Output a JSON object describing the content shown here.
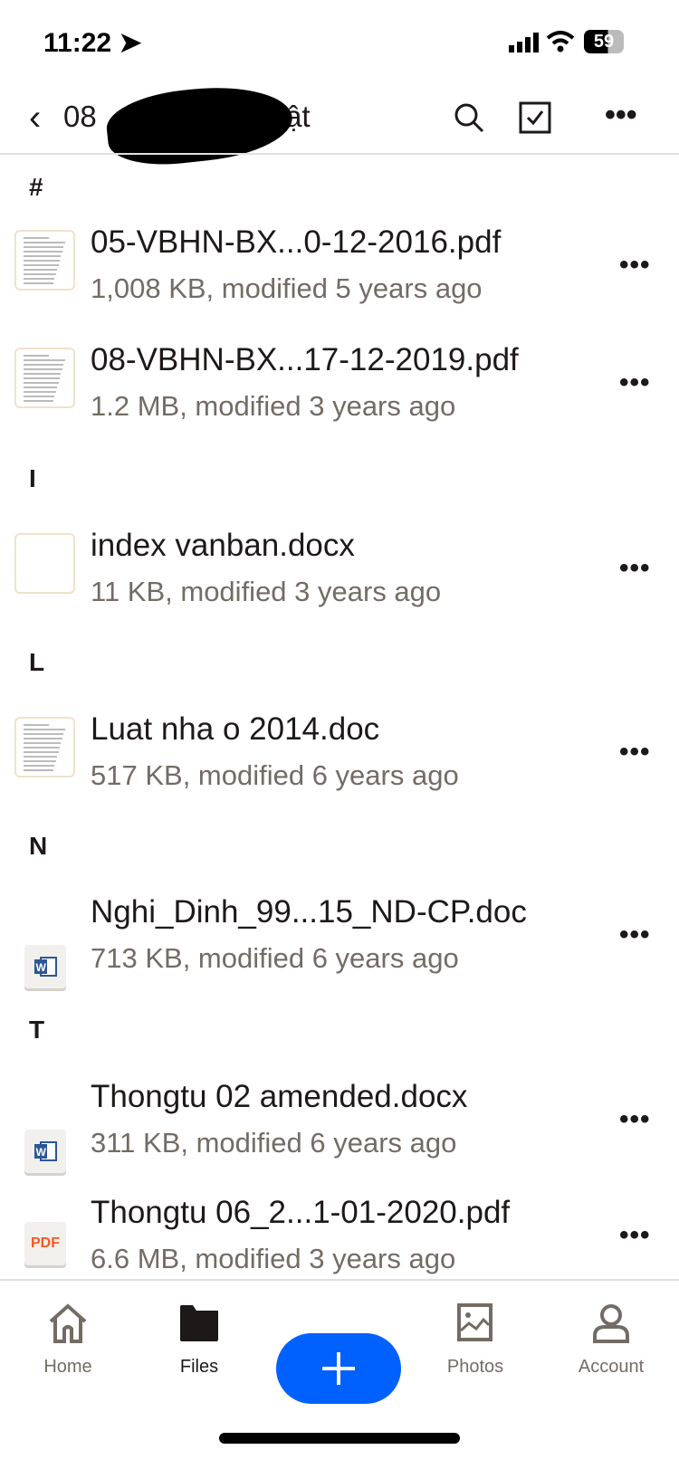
{
  "status": {
    "time": "11:22",
    "battery": "59"
  },
  "nav": {
    "title_start": "08",
    "title_end": "uật"
  },
  "sections": [
    {
      "header": "#",
      "files": [
        {
          "name": "05-VBHN-BX...0-12-2016.pdf",
          "meta": "1,008 KB, modified 5 years ago",
          "icon": "document-thumbnail"
        },
        {
          "name": "08-VBHN-BX...17-12-2019.pdf",
          "meta": "1.2 MB, modified 3 years ago",
          "icon": "document-thumbnail"
        }
      ]
    },
    {
      "header": "I",
      "files": [
        {
          "name": "index vanban.docx",
          "meta": "11 KB, modified 3 years ago",
          "icon": "blank-thumbnail"
        }
      ]
    },
    {
      "header": "L",
      "files": [
        {
          "name": "Luat nha o 2014.doc",
          "meta": "517 KB, modified 6 years ago",
          "icon": "document-thumbnail"
        }
      ]
    },
    {
      "header": "N",
      "files": [
        {
          "name": "Nghi_Dinh_99...15_ND-CP.doc",
          "meta": "713 KB, modified 6 years ago",
          "icon": "word-icon"
        }
      ]
    },
    {
      "header": "T",
      "files": [
        {
          "name": "Thongtu 02 amended.docx",
          "meta": "311 KB, modified 6 years ago",
          "icon": "word-icon"
        },
        {
          "name": "Thongtu 06_2...1-01-2020.pdf",
          "meta": "6.6 MB, modified 3 years ago",
          "icon": "pdf-icon",
          "icon_text": "PDF"
        }
      ]
    }
  ],
  "tabs": [
    {
      "label": "Home"
    },
    {
      "label": "Files",
      "active": true
    },
    {
      "label": "Photos"
    },
    {
      "label": "Account"
    }
  ],
  "colors": {
    "accent": "#0061fe",
    "pdf": "#f15a24",
    "word": "#2b5797"
  }
}
